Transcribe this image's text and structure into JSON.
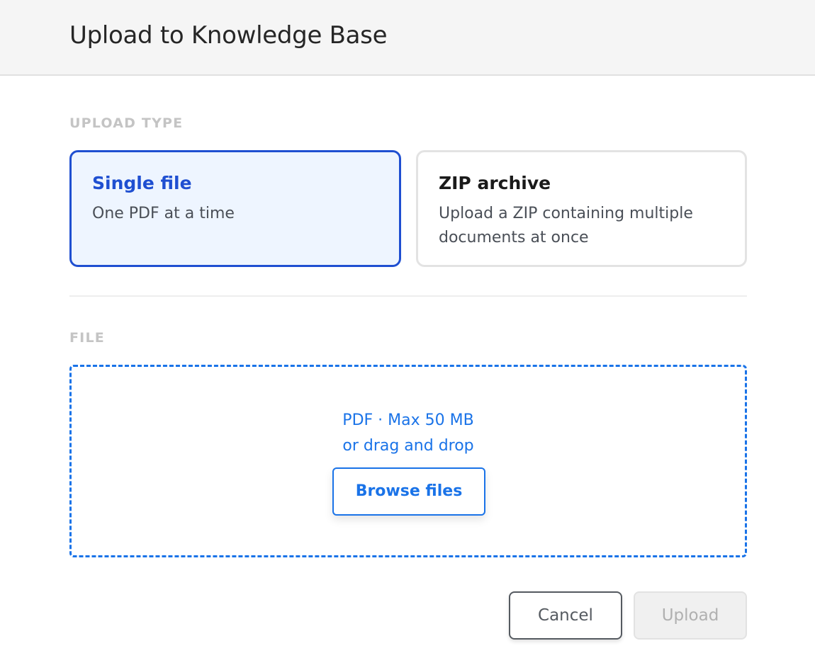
{
  "dialog": {
    "title": "Upload to Knowledge Base"
  },
  "upload_type": {
    "section_label": "UPLOAD TYPE",
    "selected": "single",
    "options": [
      {
        "id": "single",
        "title": "Single file",
        "description": "One PDF at a time"
      },
      {
        "id": "zip",
        "title": "ZIP archive",
        "description": "Upload a ZIP containing multiple documents at once"
      }
    ]
  },
  "file": {
    "section_label": "FILE",
    "hint_line1": "PDF · Max 50 MB",
    "hint_line2": "or drag and drop",
    "browse_label": "Browse files"
  },
  "footer": {
    "cancel_label": "Cancel",
    "upload_label": "Upload",
    "upload_enabled": false
  },
  "colors": {
    "accent": "#1f4fd1",
    "link_blue": "#1a73e8",
    "selected_card_bg": "#eef5ff",
    "section_label": "#c4c4c4",
    "disabled_bg": "#f0f0f0"
  }
}
